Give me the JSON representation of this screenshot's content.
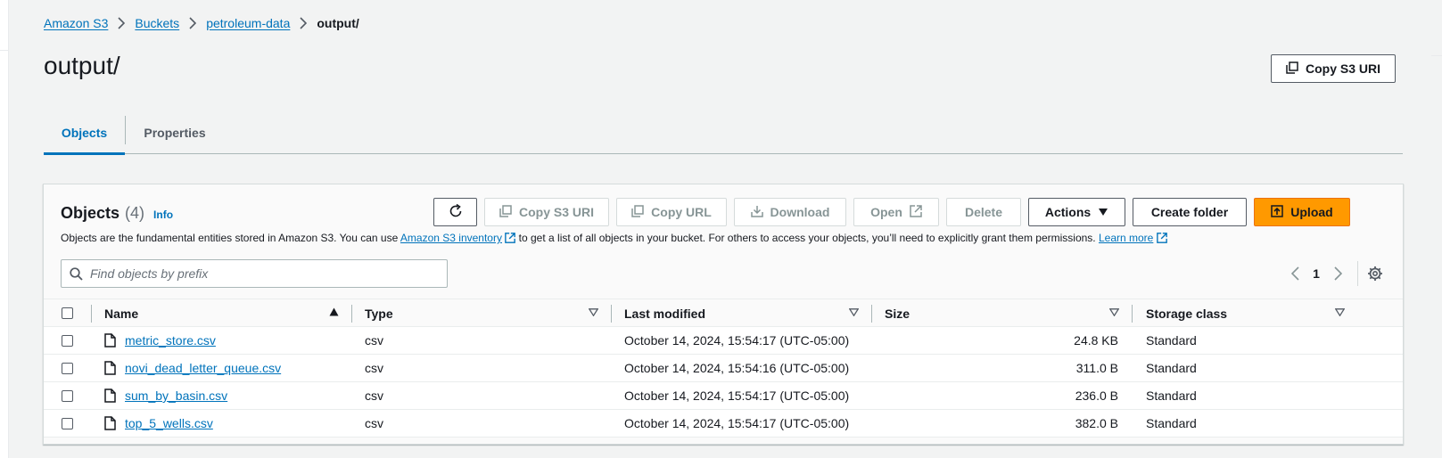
{
  "breadcrumb": {
    "items": [
      "Amazon S3",
      "Buckets",
      "petroleum-data"
    ],
    "current": "output/"
  },
  "page": {
    "title": "output/",
    "copy_s3_uri_label": "Copy S3 URI"
  },
  "tabs": [
    {
      "label": "Objects",
      "active": true
    },
    {
      "label": "Properties",
      "active": false
    }
  ],
  "objects_panel": {
    "title": "Objects",
    "count": "(4)",
    "info_label": "Info",
    "description_pre": "Objects are the fundamental entities stored in Amazon S3. You can use ",
    "inventory_link": "Amazon S3 inventory",
    "description_mid": " to get a list of all objects in your bucket. For others to access your objects, you’ll need to explicitly grant them permissions. ",
    "learn_more": "Learn more",
    "toolbar": {
      "copy_s3_uri": "Copy S3 URI",
      "copy_url": "Copy URL",
      "download": "Download",
      "open": "Open",
      "delete": "Delete",
      "actions": "Actions",
      "create_folder": "Create folder",
      "upload": "Upload"
    },
    "search": {
      "placeholder": "Find objects by prefix",
      "value": ""
    },
    "pagination": {
      "current_page": "1"
    }
  },
  "table": {
    "columns": [
      "Name",
      "Type",
      "Last modified",
      "Size",
      "Storage class"
    ],
    "rows": [
      {
        "name": "metric_store.csv",
        "type": "csv",
        "last_modified": "October 14, 2024, 15:54:17 (UTC-05:00)",
        "size": "24.8 KB",
        "storage_class": "Standard"
      },
      {
        "name": "novi_dead_letter_queue.csv",
        "type": "csv",
        "last_modified": "October 14, 2024, 15:54:16 (UTC-05:00)",
        "size": "311.0 B",
        "storage_class": "Standard"
      },
      {
        "name": "sum_by_basin.csv",
        "type": "csv",
        "last_modified": "October 14, 2024, 15:54:17 (UTC-05:00)",
        "size": "236.0 B",
        "storage_class": "Standard"
      },
      {
        "name": "top_5_wells.csv",
        "type": "csv",
        "last_modified": "October 14, 2024, 15:54:17 (UTC-05:00)",
        "size": "382.0 B",
        "storage_class": "Standard"
      }
    ]
  },
  "colors": {
    "link": "#0073bb",
    "primary_button": "#ff9900",
    "background": "#f2f3f3"
  },
  "icons": [
    "chevron-right-icon",
    "copy-icon",
    "refresh-icon",
    "download-icon",
    "external-link-icon",
    "caret-down-icon",
    "upload-icon",
    "search-icon",
    "chevron-left-icon",
    "gear-icon",
    "file-icon",
    "sort-ascending-icon",
    "sort-descending-icon"
  ]
}
